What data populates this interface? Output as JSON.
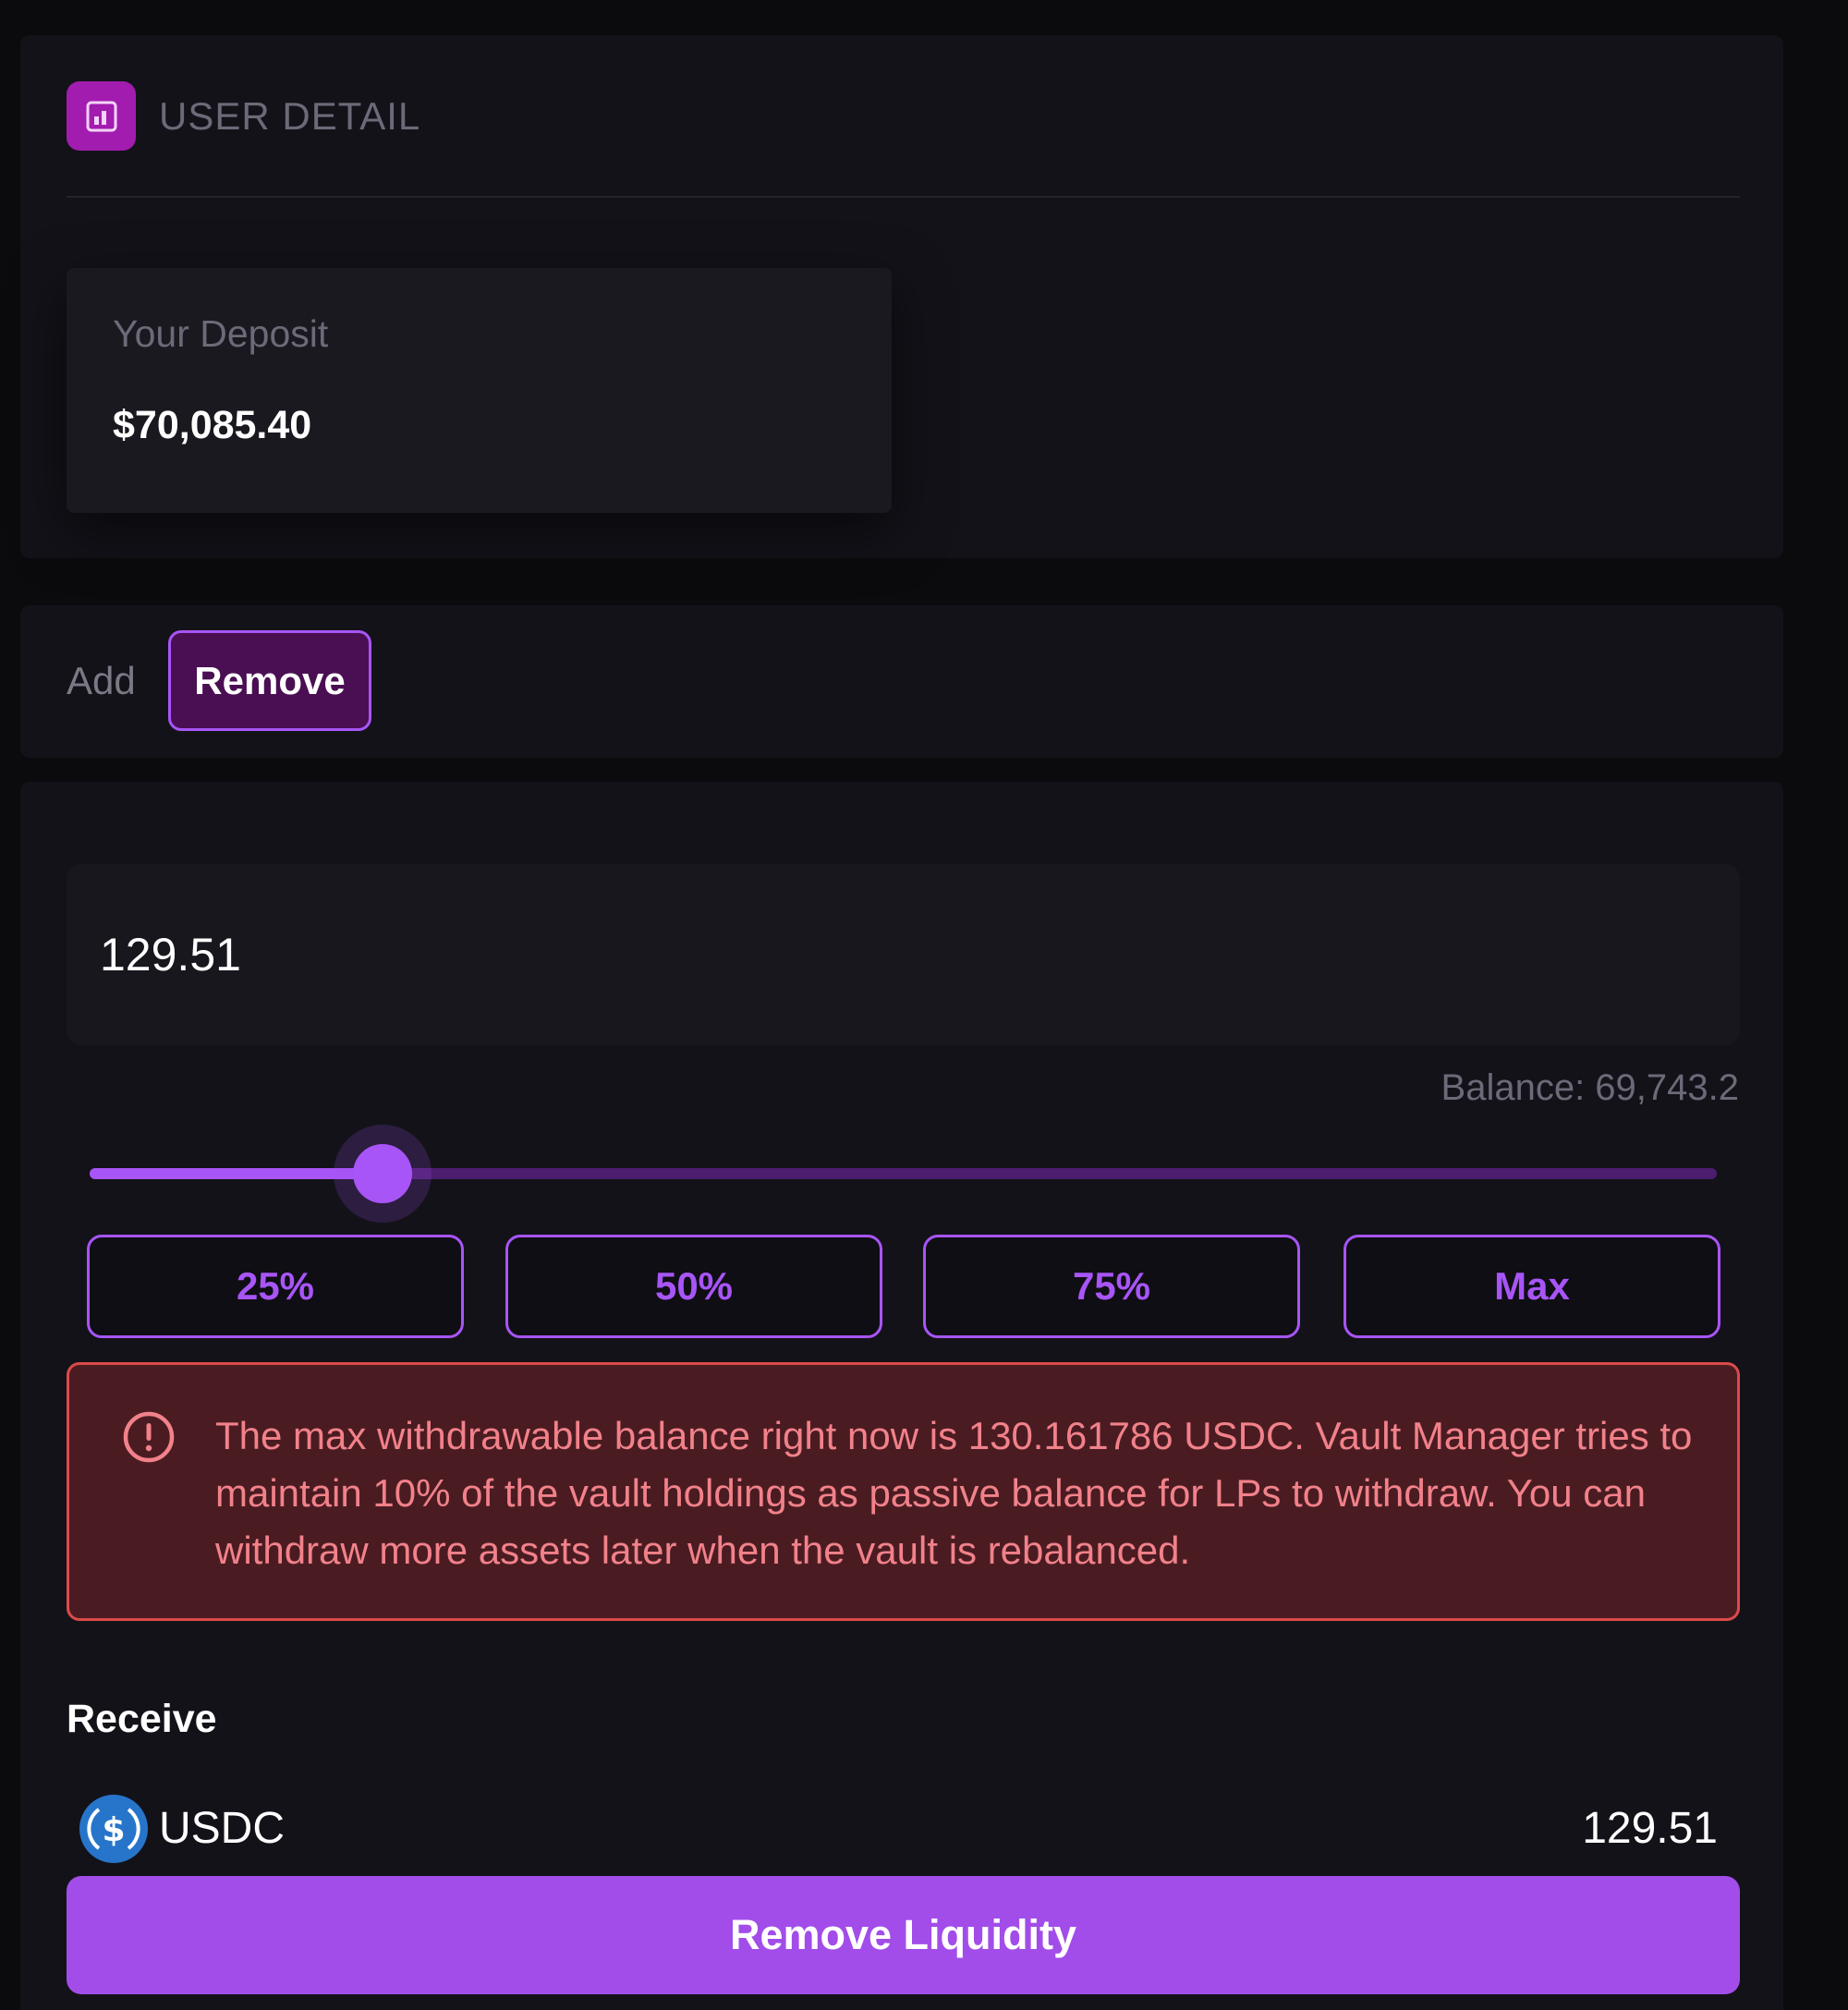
{
  "user_detail": {
    "icon": "chart-square-icon",
    "title": "USER DETAIL",
    "deposit_label": "Your Deposit",
    "deposit_value": "$70,085.40"
  },
  "tabs": [
    {
      "label": "Add",
      "active": false
    },
    {
      "label": "Remove",
      "active": true
    }
  ],
  "withdraw": {
    "amount_value": "129.51",
    "balance_text": "Balance: 69,743.2",
    "slider_percent": 18,
    "percent_buttons": [
      "25%",
      "50%",
      "75%",
      "Max"
    ],
    "alert_icon": "exclamation-circle-icon",
    "alert_text": "The max withdrawable balance right now is 130.161786 USDC. Vault Manager tries to maintain 10% of the vault holdings as passive balance for LPs to withdraw. You can withdraw more assets later when the vault is rebalanced."
  },
  "receive": {
    "label": "Receive",
    "token_icon": "usdc-icon",
    "token": "USDC",
    "amount": "129.51"
  },
  "submit_label": "Remove Liquidity",
  "colors": {
    "accent": "#a855f7",
    "alert_bg": "#4a1c22",
    "alert_border": "#dc4a4a",
    "alert_text": "#f2818a",
    "panel_bg": "#131219"
  }
}
